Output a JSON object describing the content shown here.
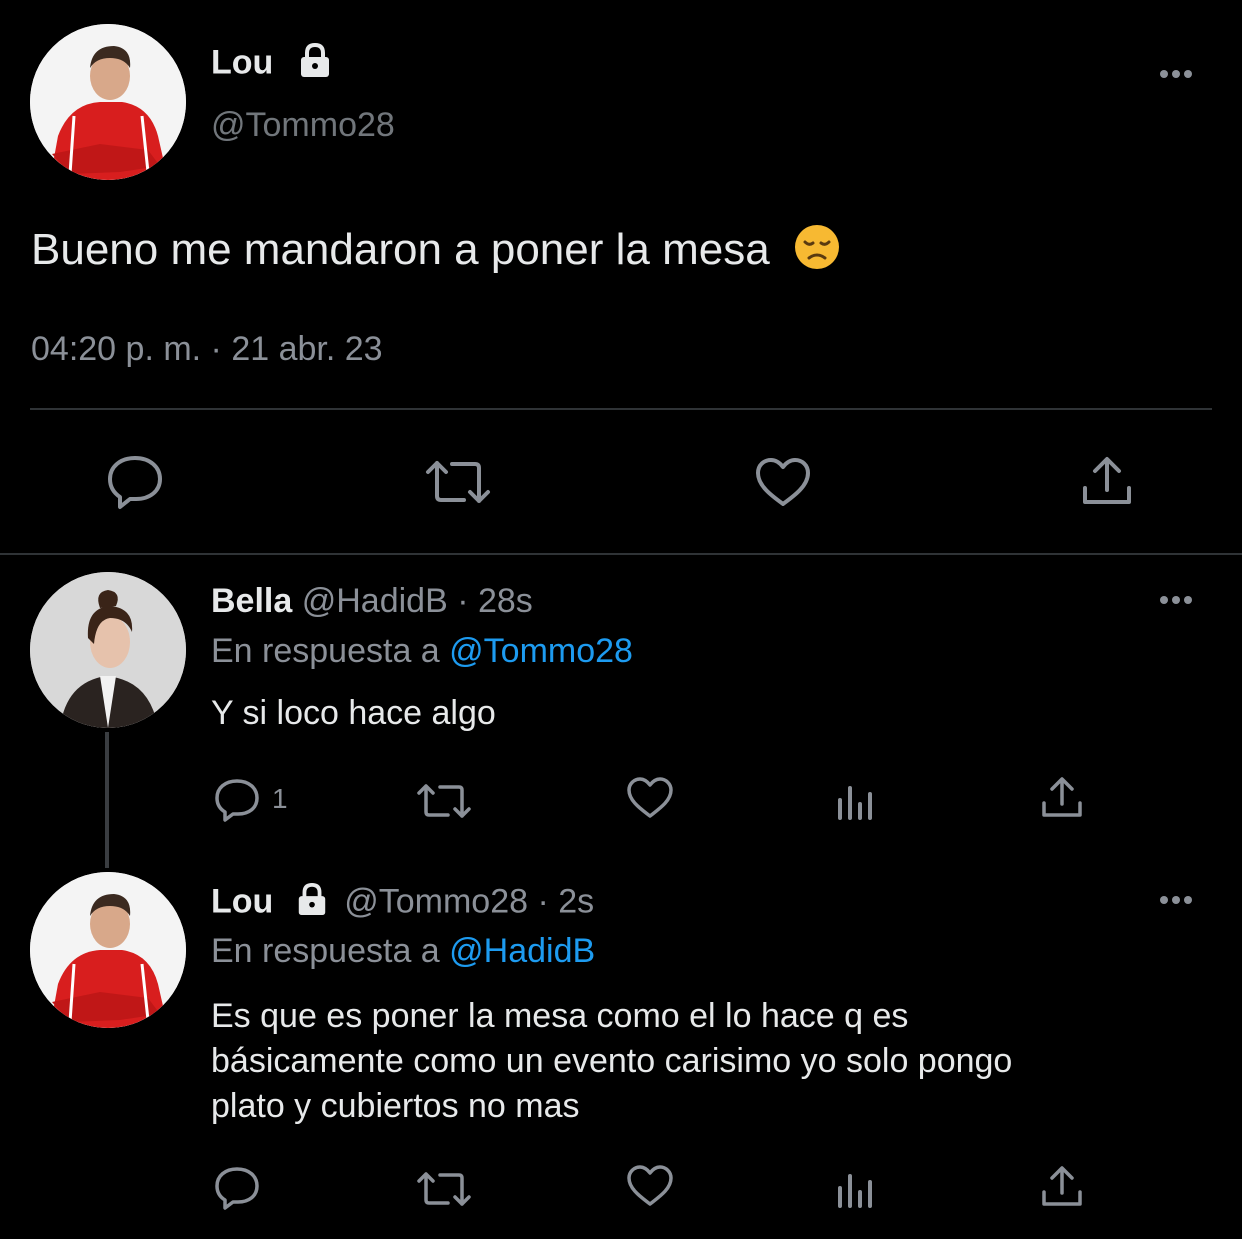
{
  "main_tweet": {
    "display_name": "Lou",
    "handle": "@Tommo28",
    "text": "Bueno me mandaron a poner la mesa",
    "emoji": "disappointed-face-emoji",
    "timestamp": "04:20 p. m. · 21 abr. 23"
  },
  "reply1": {
    "display_name": "Bella",
    "handle": "@HadidB",
    "time": "· 28s",
    "reply_prefix": "En respuesta a",
    "reply_to": "@Tommo28",
    "text": "Y si loco hace algo",
    "reply_count": "1"
  },
  "reply2": {
    "display_name": "Lou",
    "handle": "@Tommo28",
    "time": "· 2s",
    "reply_prefix": "En respuesta a",
    "reply_to": "@HadidB",
    "text_lines": [
      "Es que es poner la mesa como el lo hace q es",
      "básicamente como un evento carisimo yo solo pongo",
      "plato y cubiertos no mas"
    ]
  },
  "colors": {
    "background": "#000000",
    "text": "#e7e9ea",
    "muted": "#71767b",
    "link": "#1d9bf0",
    "divider": "#2f3336",
    "icon": "#8b9098"
  }
}
